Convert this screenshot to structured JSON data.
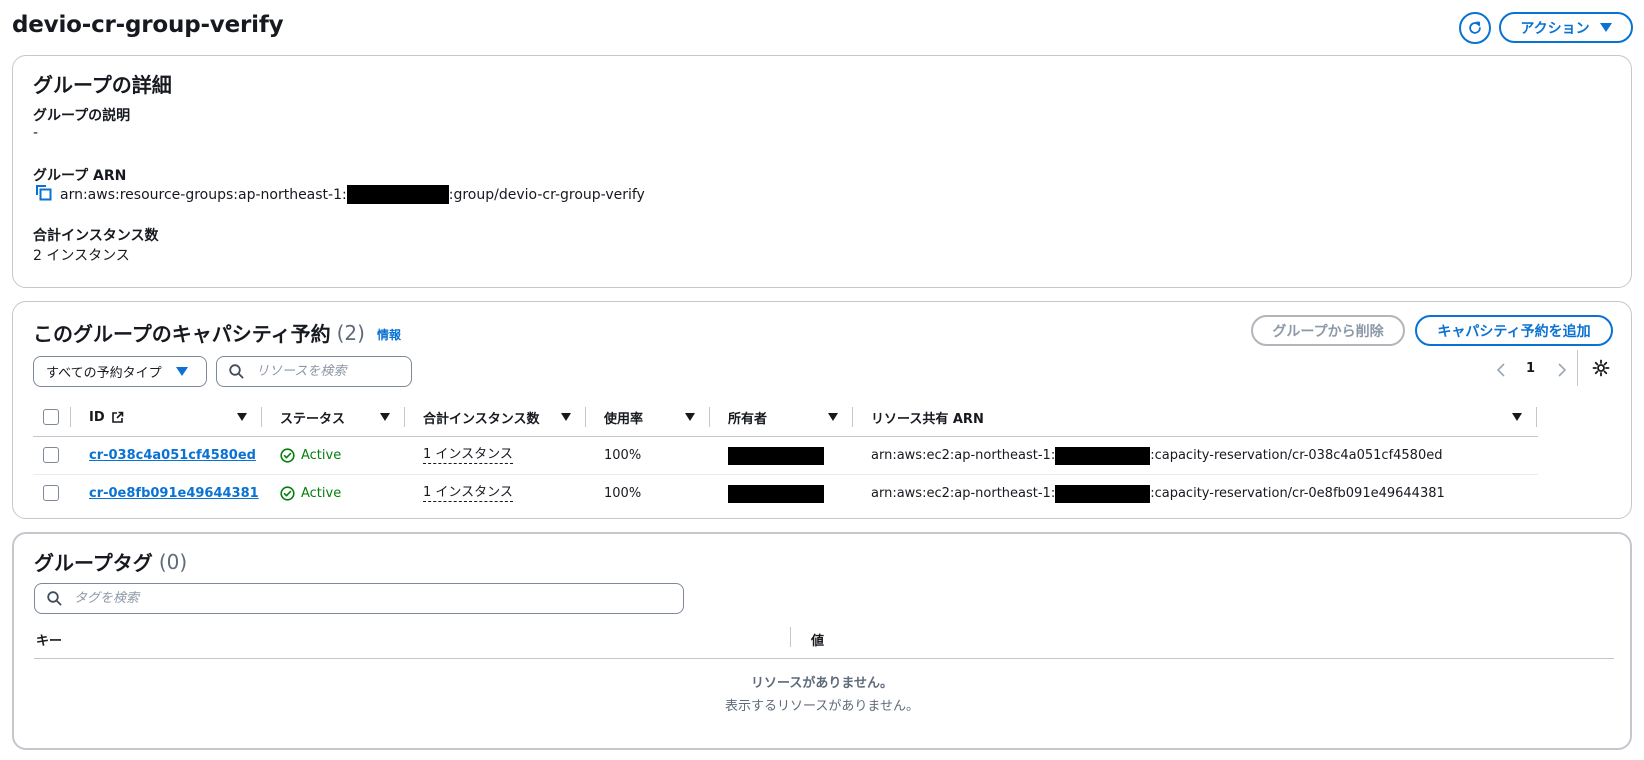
{
  "page": {
    "title": "devio-cr-group-verify",
    "actions_label": "アクション"
  },
  "details": {
    "heading": "グループの詳細",
    "description_label": "グループの説明",
    "description_value": "-",
    "arn_label": "グループ ARN",
    "arn_prefix": "arn:aws:resource-groups:ap-northeast-1:",
    "arn_suffix": ":group/devio-cr-group-verify",
    "total_label": "合計インスタンス数",
    "total_value": "2 インスタンス"
  },
  "reservations": {
    "heading": "このグループのキャパシティ予約",
    "count": "(2)",
    "info_link": "情報",
    "remove_button": "グループから削除",
    "add_button": "キャパシティ予約を追加",
    "filter_select": "すべての予約タイプ",
    "search_placeholder": "リソースを検索",
    "page_number": "1",
    "columns": [
      "ID",
      "ステータス",
      "合計インスタンス数",
      "使用率",
      "所有者",
      "リソース共有 ARN"
    ],
    "rows": [
      {
        "id": "cr-038c4a051cf4580ed",
        "status": "Active",
        "instances": "1 インスタンス",
        "utilization": "100%",
        "arn_prefix": "arn:aws:ec2:ap-northeast-1:",
        "arn_suffix": ":capacity-reservation/cr-038c4a051cf4580ed"
      },
      {
        "id": "cr-0e8fb091e49644381",
        "status": "Active",
        "instances": "1 インスタンス",
        "utilization": "100%",
        "arn_prefix": "arn:aws:ec2:ap-northeast-1:",
        "arn_suffix": ":capacity-reservation/cr-0e8fb091e49644381"
      }
    ]
  },
  "tags": {
    "heading": "グループタグ",
    "count": "(0)",
    "search_placeholder": "タグを検索",
    "columns": [
      "キー",
      "値"
    ],
    "empty_title": "リソースがありません。",
    "empty_subtitle": "表示するリソースがありません。"
  },
  "colors": {
    "accent": "#0972d3",
    "success": "#037f0c",
    "border": "#c6c6cd",
    "muted": "#5f6b7a"
  }
}
